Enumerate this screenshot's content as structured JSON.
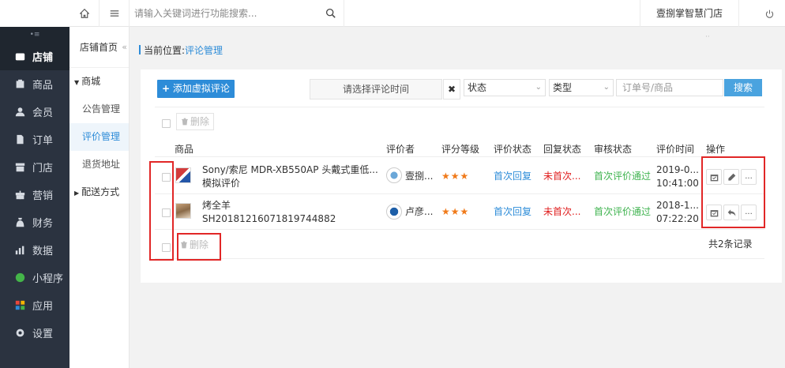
{
  "topbar": {
    "search_placeholder": "请输入关键词进行功能搜索...",
    "store_name": "壹捌掌智慧门店"
  },
  "sidebar": {
    "collapse": "•≡",
    "items": [
      {
        "label": "店铺",
        "icon": "store-icon",
        "active": true
      },
      {
        "label": "商品",
        "icon": "goods-icon"
      },
      {
        "label": "会员",
        "icon": "member-icon"
      },
      {
        "label": "订单",
        "icon": "order-icon"
      },
      {
        "label": "门店",
        "icon": "shop-icon"
      },
      {
        "label": "营销",
        "icon": "marketing-icon"
      },
      {
        "label": "财务",
        "icon": "finance-icon"
      },
      {
        "label": "数据",
        "icon": "data-icon"
      },
      {
        "label": "小程序",
        "icon": "miniapp-icon"
      },
      {
        "label": "应用",
        "icon": "apps-icon"
      },
      {
        "label": "设置",
        "icon": "settings-icon"
      }
    ]
  },
  "submenu": {
    "home": "店铺首页",
    "collapse": "«",
    "group_mall": "商城",
    "items": [
      "公告管理",
      "评价管理",
      "退货地址"
    ],
    "group_delivery": "配送方式"
  },
  "breadcrumb": {
    "prefix": "当前位置:",
    "current": "评论管理"
  },
  "filters": {
    "add_label": "添加虚拟评论",
    "date_placeholder": "请选择评论时间",
    "clear": "✖",
    "status": "状态",
    "type": "类型",
    "order_placeholder": "订单号/商品",
    "search": "搜索"
  },
  "actions": {
    "delete": "删除"
  },
  "table": {
    "headers": [
      "商品",
      "评价者",
      "评分等级",
      "评价状态",
      "回复状态",
      "审核状态",
      "评价时间",
      "操作"
    ],
    "rows": [
      {
        "product_line1": "Sony/索尼 MDR-XB550AP 头戴式重低...",
        "product_line2": "模拟评价",
        "reviewer": "壹捌...",
        "stars": "★★★",
        "review_status": "首次回复",
        "reply_status": "未首次...",
        "audit_status": "首次评价通过",
        "time_line1": "2019-0...",
        "time_line2": "10:41:00"
      },
      {
        "product_line1": "烤全羊",
        "product_line2": "SH20181216071819744882",
        "reviewer": "卢彦...",
        "stars": "★★★",
        "review_status": "首次回复",
        "reply_status": "未首次...",
        "audit_status": "首次评价通过",
        "time_line1": "2018-1...",
        "time_line2": "07:22:20"
      }
    ],
    "more": "..."
  },
  "footer": {
    "total": "共2条记录"
  },
  "colors": {
    "sidebar_bg": "#2b3340",
    "accent": "#2d8cd8",
    "star": "#f07a1a",
    "red": "#e02020",
    "green": "#3fb34f",
    "highlight_box": "#e12727"
  }
}
